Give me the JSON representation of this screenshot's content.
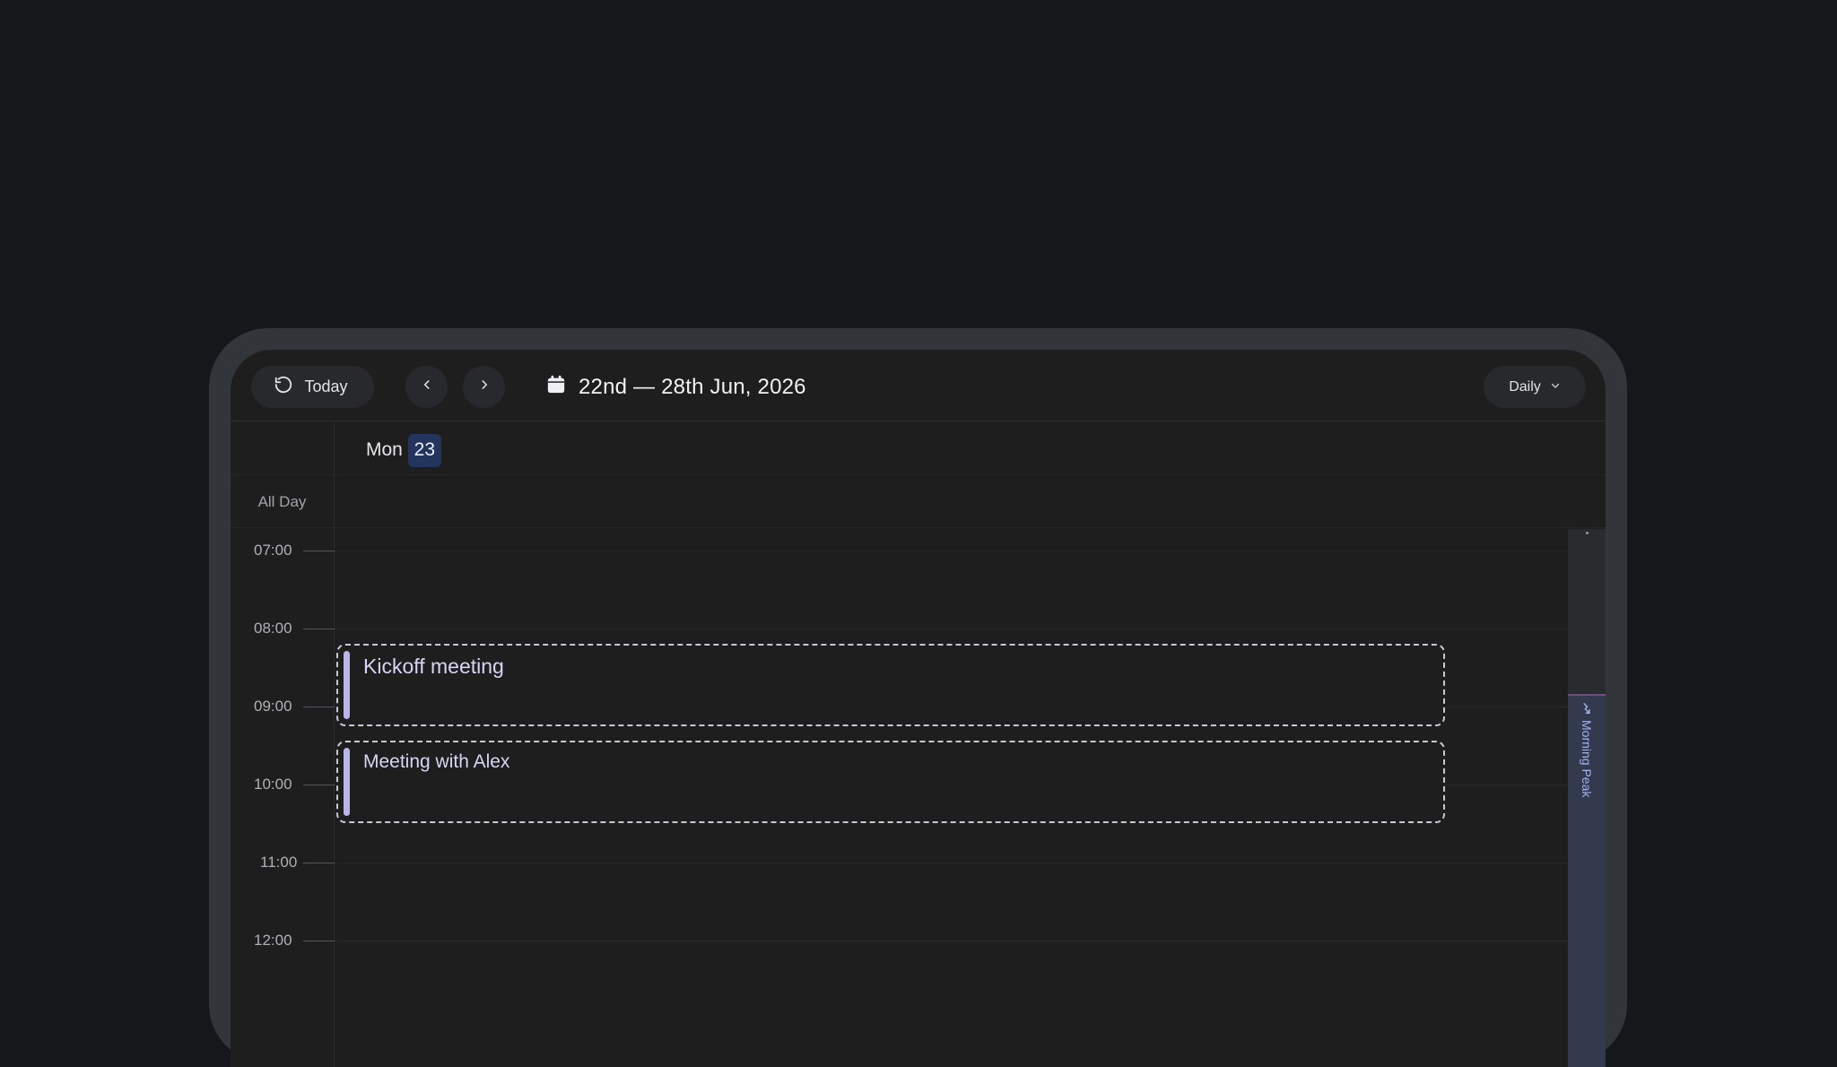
{
  "toolbar": {
    "today_label": "Today",
    "date_range": "22nd — 28th Jun, 2026",
    "view_label": "Daily"
  },
  "day_header": {
    "weekday": "Mon",
    "day_number": "23"
  },
  "all_day_label": "All Day",
  "hours": [
    "07:00",
    "08:00",
    "09:00",
    "10:00",
    "11:00",
    "12:00"
  ],
  "events": [
    {
      "title": "Kickoff meeting"
    },
    {
      "title": "Meeting with Alex"
    }
  ],
  "rail": {
    "peak_label": "Morning Peak"
  },
  "colors": {
    "background": "#15171b",
    "panel": "#1e1e1f",
    "today_badge": "#23355c",
    "event_accent": "#b8b6ea",
    "peak_band": "#343a4d"
  }
}
